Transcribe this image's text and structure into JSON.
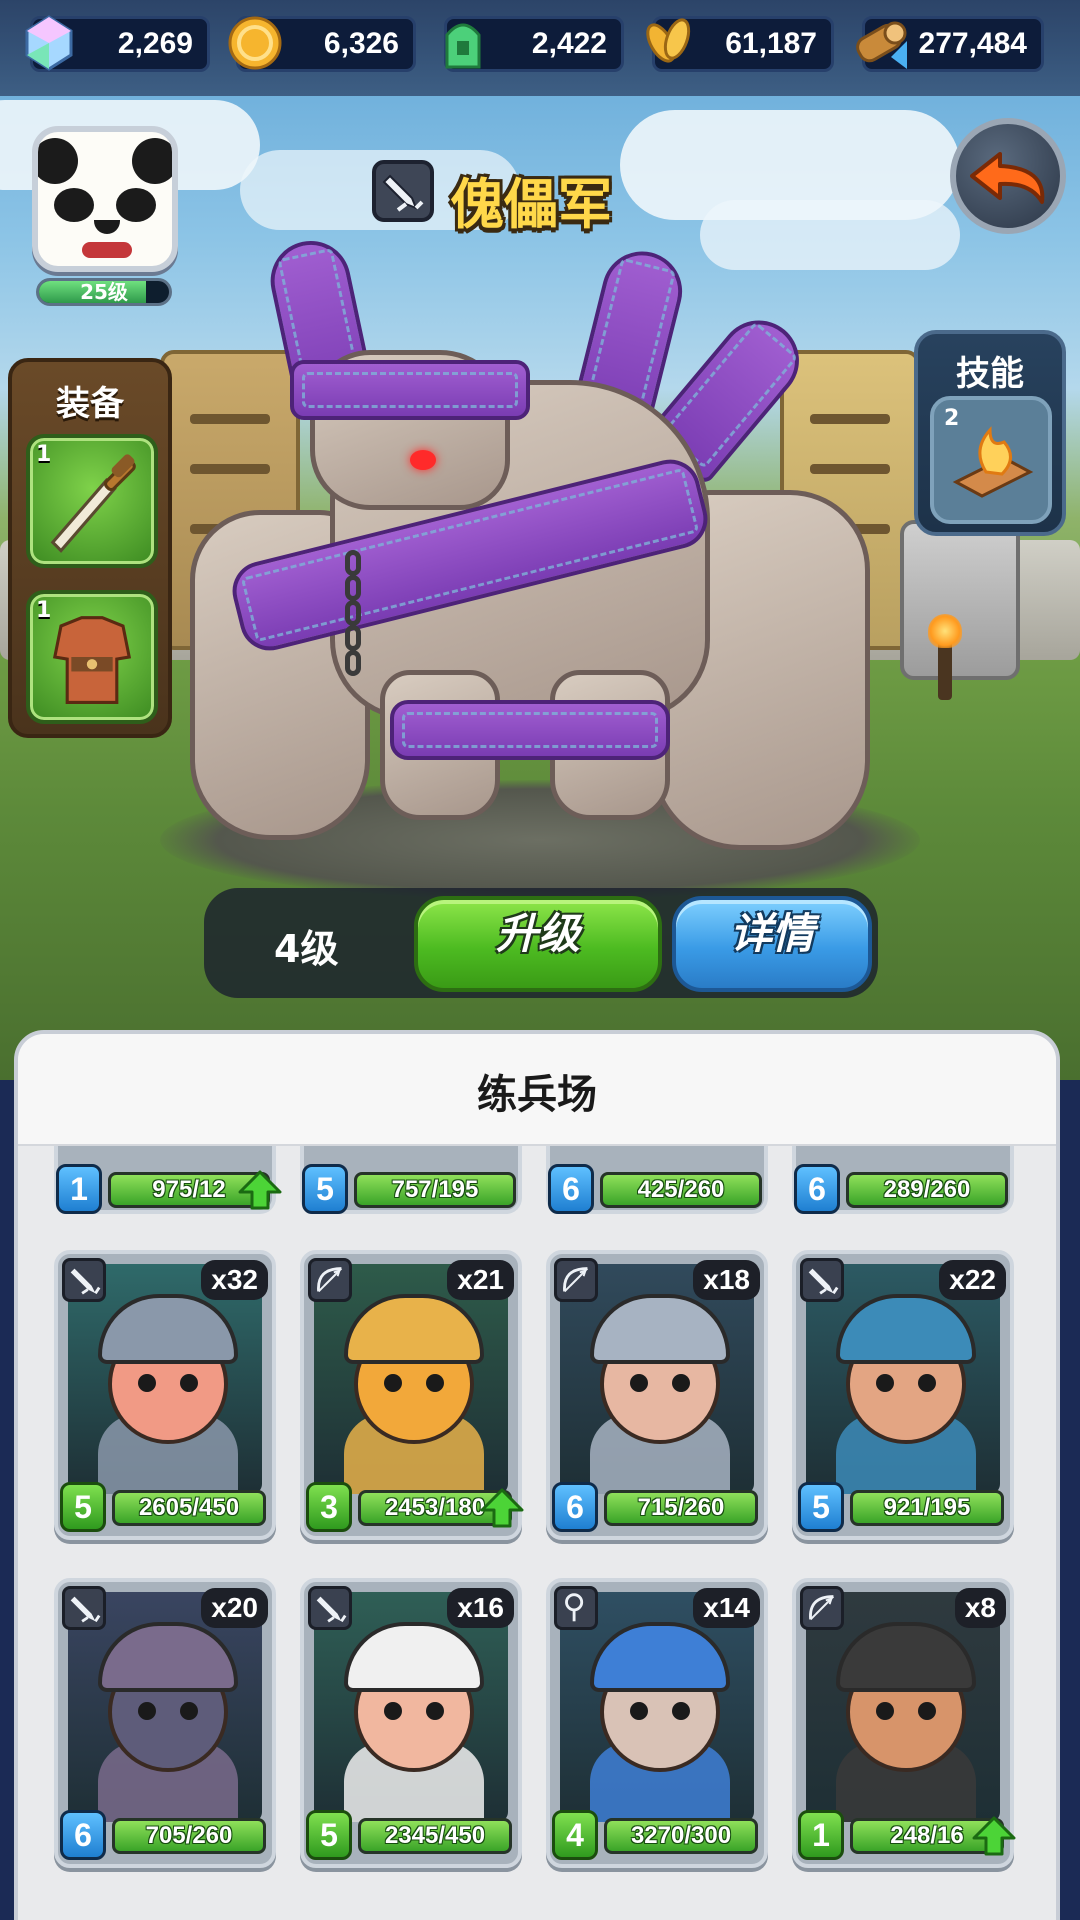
{
  "resources": [
    {
      "name": "gems",
      "icon": "gem-icon",
      "value": "2,269"
    },
    {
      "name": "gold",
      "icon": "gold-coin-icon",
      "value": "6,326"
    },
    {
      "name": "tokens",
      "icon": "green-token-icon",
      "value": "2,422"
    },
    {
      "name": "grain",
      "icon": "wheat-icon",
      "value": "61,187"
    },
    {
      "name": "wood",
      "icon": "wood-log-icon",
      "value": "277,484"
    }
  ],
  "player": {
    "level_label": "25级",
    "level_progress": 0.82
  },
  "unit": {
    "type_icon": "sword-icon",
    "name": "傀儡军",
    "level_label": "4级"
  },
  "equipment": {
    "title": "装备",
    "slots": [
      {
        "icon": "dagger-icon",
        "count": "1"
      },
      {
        "icon": "armor-icon",
        "count": "1"
      }
    ]
  },
  "skills": {
    "title": "技能",
    "slot": {
      "icon": "fire-skill-icon",
      "count": "2"
    }
  },
  "actions": {
    "upgrade_label": "升级",
    "detail_label": "详情"
  },
  "barracks": {
    "title": "练兵场",
    "top_row": [
      {
        "level": "1",
        "progress": "975/12",
        "upgradeable": true
      },
      {
        "level": "5",
        "progress": "757/195",
        "upgradeable": false
      },
      {
        "level": "6",
        "progress": "425/260",
        "upgradeable": false
      },
      {
        "level": "6",
        "progress": "289/260",
        "upgradeable": false
      }
    ],
    "cards": [
      {
        "type_icon": "sword-icon",
        "count": "x32",
        "level": "5",
        "level_color": "green",
        "progress": "2605/450",
        "upgradeable": false,
        "name": "knight"
      },
      {
        "type_icon": "bow-icon",
        "count": "x21",
        "level": "3",
        "level_color": "green",
        "progress": "2453/180",
        "upgradeable": true,
        "name": "eagle-archer"
      },
      {
        "type_icon": "bow-icon",
        "count": "x18",
        "level": "6",
        "level_color": "blue",
        "progress": "715/260",
        "upgradeable": false,
        "name": "musketeer"
      },
      {
        "type_icon": "sword-icon",
        "count": "x22",
        "level": "5",
        "level_color": "blue",
        "progress": "921/195",
        "upgradeable": false,
        "name": "guard"
      },
      {
        "type_icon": "sword-icon",
        "count": "x20",
        "level": "6",
        "level_color": "blue",
        "progress": "705/260",
        "upgradeable": false,
        "name": "shield-bearer"
      },
      {
        "type_icon": "sword-icon",
        "count": "x16",
        "level": "5",
        "level_color": "green",
        "progress": "2345/450",
        "upgradeable": false,
        "name": "polar-bear-warrior"
      },
      {
        "type_icon": "magic-icon",
        "count": "x14",
        "level": "4",
        "level_color": "green",
        "progress": "3270/300",
        "upgradeable": false,
        "name": "bomber"
      },
      {
        "type_icon": "bow-icon",
        "count": "x8",
        "level": "1",
        "level_color": "green",
        "progress": "248/16",
        "upgradeable": true,
        "name": "crossbowman"
      }
    ]
  }
}
